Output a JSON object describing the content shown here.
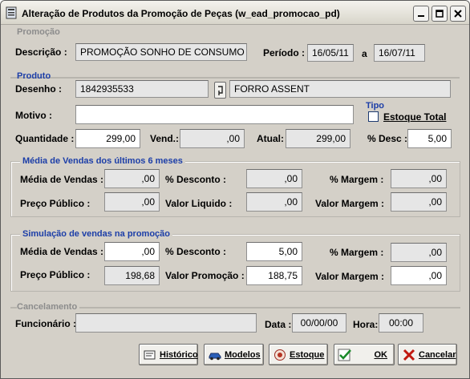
{
  "window": {
    "title": "Alteração de Produtos da Promoção de Peças (w_ead_promocao_pd)"
  },
  "promocao": {
    "group_label": "Promoção",
    "descricao_label": "Descrição :",
    "descricao_value": "PROMOÇÃO SONHO DE CONSUMO",
    "periodo_label": "Período :",
    "periodo_start": "16/05/11",
    "periodo_sep": "a",
    "periodo_end": "16/07/11"
  },
  "produto": {
    "group_label": "Produto",
    "desenho_label": "Desenho :",
    "desenho_value": "1842935533",
    "nome_value": "FORRO ASSENT",
    "motivo_label": "Motivo :",
    "motivo_value": "",
    "tipo_label": "Tipo",
    "estoque_total_label": "Estoque Total",
    "estoque_total_checked": false,
    "quantidade_label": "Quantidade :",
    "quantidade_value": "299,00",
    "vend_label": "Vend.:",
    "vend_value": ",00",
    "atual_label": "Atual:",
    "atual_value": "299,00",
    "desc_label": "% Desc :",
    "desc_value": "5,00"
  },
  "media": {
    "group_label": "Média de Vendas dos últimos 6 meses",
    "media_vendas_label": "Média de Vendas :",
    "media_vendas_value": ",00",
    "desconto_label": "% Desconto :",
    "desconto_value": ",00",
    "margem_label": "% Margem :",
    "margem_value": ",00",
    "preco_label": "Preço Público :",
    "preco_value": ",00",
    "valor_liquido_label": "Valor Liquido :",
    "valor_liquido_value": ",00",
    "valor_margem_label": "Valor Margem :",
    "valor_margem_value": ",00"
  },
  "simulacao": {
    "group_label": "Simulação de vendas na promoção",
    "media_vendas_label": "Média de Vendas :",
    "media_vendas_value": ",00",
    "desconto_label": "% Desconto :",
    "desconto_value": "5,00",
    "margem_label": "% Margem :",
    "margem_value": ",00",
    "preco_label": "Preço Público :",
    "preco_value": "198,68",
    "valor_promocao_label": "Valor Promoção :",
    "valor_promocao_value": "188,75",
    "valor_margem_label": "Valor Margem :",
    "valor_margem_value": ",00"
  },
  "cancelamento": {
    "group_label": "Cancelamento",
    "funcionario_label": "Funcionário :",
    "funcionario_value": "",
    "data_label": "Data :",
    "data_value": "00/00/00",
    "hora_label": "Hora:",
    "hora_value": "00:00"
  },
  "buttons": {
    "historico": "Histórico",
    "modelos": "Modelos",
    "estoque": "Estoque",
    "ok": "OK",
    "cancelar": "Cancelar"
  },
  "colors": {
    "group_label_blue": "#1c3ea8",
    "group_label_gray": "#8c8c8c",
    "form_bg": "#d4d0c8",
    "readonly_field": "#e6e6e6"
  }
}
